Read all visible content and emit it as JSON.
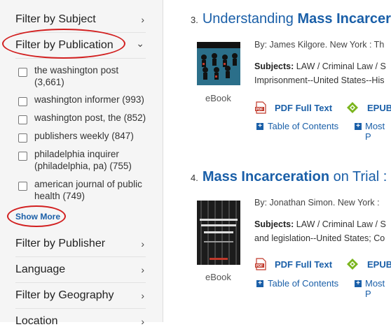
{
  "sidebar": {
    "facets_top": [
      {
        "label": "Filter by Subject",
        "chevron": "›"
      },
      {
        "label": "Filter by Publication",
        "chevron": "⌄"
      }
    ],
    "publication_options": [
      {
        "label": "the washington post (3,661)"
      },
      {
        "label": "washington informer (993)"
      },
      {
        "label": "washington post, the (852)"
      },
      {
        "label": "publishers weekly (847)"
      },
      {
        "label": "philadelphia inquirer (philadelphia, pa) (755)"
      },
      {
        "label": "american journal of public health (749)"
      }
    ],
    "show_more": "Show More",
    "facets_bottom": [
      {
        "label": "Filter by Publisher",
        "chevron": "›"
      },
      {
        "label": "Language",
        "chevron": "›"
      },
      {
        "label": "Filter by Geography",
        "chevron": "›"
      },
      {
        "label": "Location",
        "chevron": "›"
      }
    ]
  },
  "results": [
    {
      "number": "3.",
      "title_pre": "Understanding ",
      "title_bold": "Mass Incarcer",
      "byline": "By: James Kilgore. New York : Th",
      "subjects_label": "Subjects:",
      "subjects_line1": " LAW / Criminal Law / S",
      "subjects_line2": "Imprisonment--United States--His",
      "format": "eBook",
      "pdf_label": "PDF Full Text",
      "epub_label": "EPUB",
      "toc_label": "Table of Contents",
      "more_label": "Most P"
    },
    {
      "number": "4.",
      "title_pre": "",
      "title_bold": "Mass Incarceration",
      "title_post": " on Trial :",
      "byline": "By: Jonathan Simon. New York :",
      "subjects_label": "Subjects:",
      "subjects_line1": " LAW / Criminal Law / S",
      "subjects_line2": "and legislation--United States; Co",
      "format": "eBook",
      "pdf_label": "PDF Full Text",
      "epub_label": "EPUB",
      "toc_label": "Table of Contents",
      "more_label": "Most P"
    }
  ],
  "colors": {
    "link": "#1a5fa8",
    "annotation": "#d21f1f",
    "sidebar_bg": "#f5f5f5"
  }
}
